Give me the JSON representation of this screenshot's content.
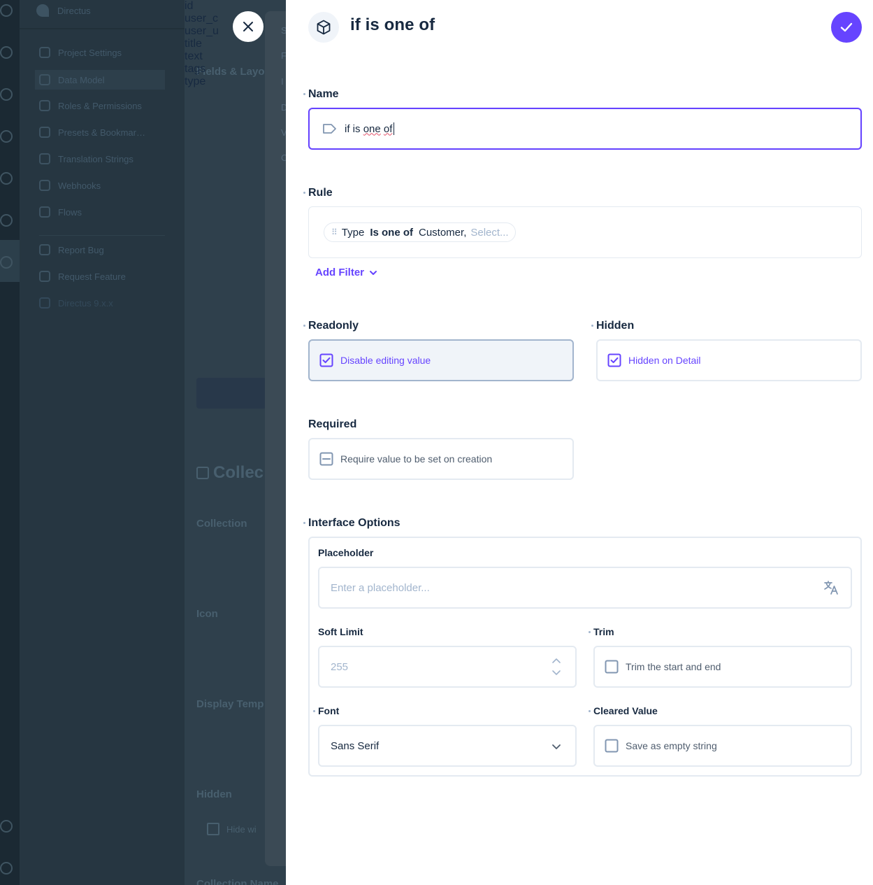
{
  "background": {
    "app_name": "Directus",
    "nav_items": [
      "Project Settings",
      "Data Model",
      "Roles & Permissions",
      "Presets & Bookmar…",
      "Translation Strings",
      "Webhooks",
      "Flows",
      "Report Bug",
      "Request Feature",
      "Directus 9.x.x"
    ],
    "section_heading": "Fields & Layo",
    "fields": [
      "id",
      "user_c",
      "user_u",
      "title",
      "text",
      "tags",
      "type"
    ],
    "collection_heading": "Collec",
    "labels": [
      "Collection",
      "Icon",
      "Display Temp",
      "Hidden",
      "Collection Name"
    ],
    "hidden_checkbox_label": "Hide wi",
    "side_tabs": [
      "S",
      "F",
      "I",
      "D",
      "V",
      "C"
    ]
  },
  "drawer": {
    "title": "if is one of",
    "header_icon": "cube-icon",
    "save_icon": "check-icon",
    "close_icon": "close-icon",
    "name": {
      "label": "Name",
      "value_words": [
        "if",
        "is",
        "one",
        "of"
      ],
      "icon": "tag-icon"
    },
    "rule": {
      "label": "Rule",
      "field": "Type",
      "operator": "Is one of",
      "value": "Customer,",
      "select_placeholder": "Select...",
      "add_filter_label": "Add Filter"
    },
    "readonly": {
      "label": "Readonly",
      "checkbox_label": "Disable editing value",
      "checked": true
    },
    "hidden": {
      "label": "Hidden",
      "checkbox_label": "Hidden on Detail",
      "checked": true
    },
    "required": {
      "label": "Required",
      "checkbox_label": "Require value to be set on creation",
      "state": "indeterminate"
    },
    "interface_options": {
      "label": "Interface Options",
      "placeholder": {
        "label": "Placeholder",
        "input_placeholder": "Enter a placeholder...",
        "icon": "translate-icon"
      },
      "soft_limit": {
        "label": "Soft Limit",
        "input_placeholder": "255"
      },
      "trim": {
        "label": "Trim",
        "checkbox_label": "Trim the start and end",
        "checked": false
      },
      "font": {
        "label": "Font",
        "selected": "Sans Serif"
      },
      "cleared_value": {
        "label": "Cleared Value",
        "checkbox_label": "Save as empty string",
        "checked": false
      }
    }
  },
  "colors": {
    "accent": "#6644ff",
    "text": "#172940",
    "border": "#e4eaf1",
    "muted": "#a2b5cd",
    "overlay": "#2b3b48"
  }
}
